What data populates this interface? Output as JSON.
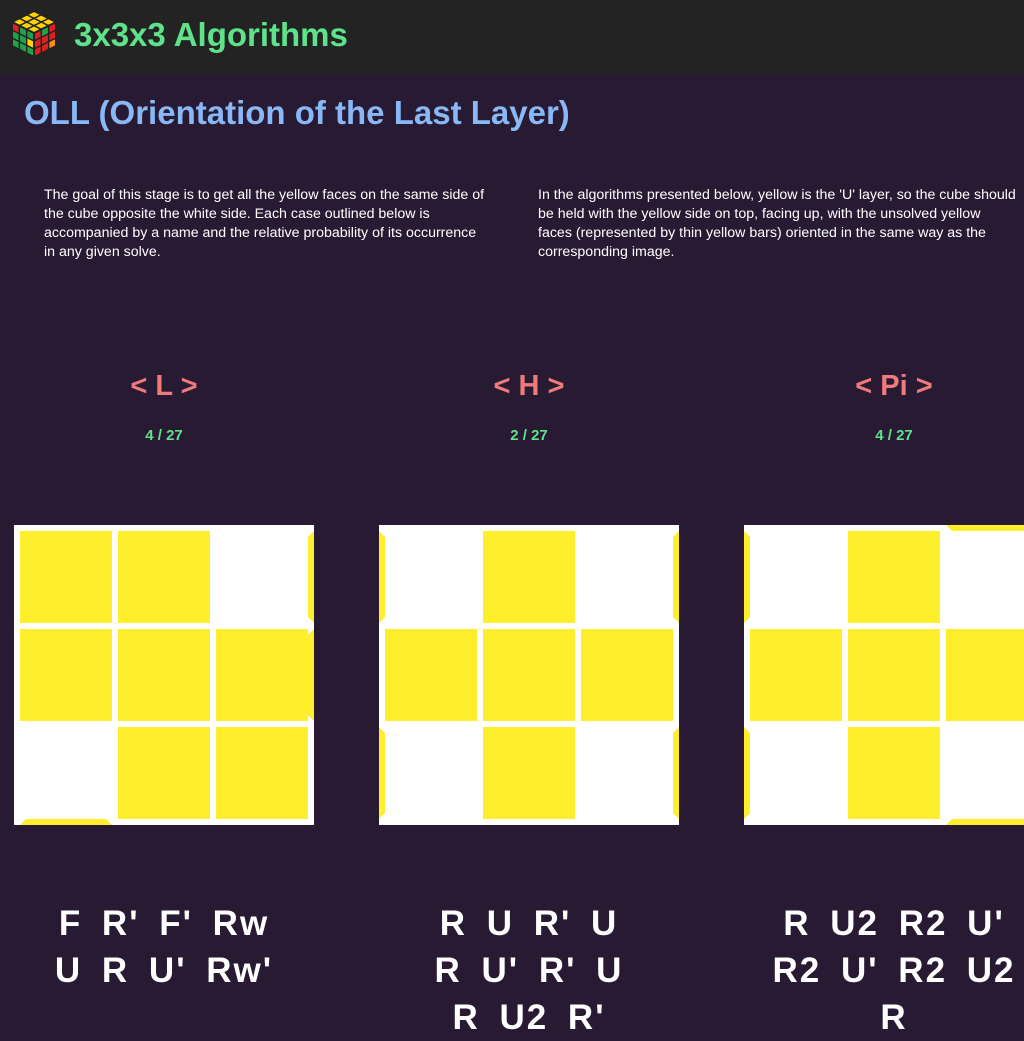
{
  "header": {
    "site_title": "3x3x3 Algorithms",
    "logo_icon": "rubiks-cube-icon"
  },
  "section": {
    "title": "OLL (Orientation of the Last Layer)",
    "intro_left": "The goal of this stage is to get all the yellow faces on the same side of the cube opposite the white side. Each case outlined below is accompanied by a name and the relative probability of its occurrence in any given solve.",
    "intro_right": "In the algorithms presented below, yellow is the 'U' layer, so the cube should be held with the yellow side on top, facing up, with the unsolved yellow faces (represented by thin yellow bars) oriented in the same way as the corresponding image."
  },
  "colors": {
    "yellow": "#ffee2c",
    "sticker_off": "#ffffff",
    "case_name": "#f07a7a",
    "probability": "#5ee38a",
    "title": "#88b8f5",
    "background": "#291a33"
  },
  "cases": [
    {
      "name": "< L >",
      "probability": "4 / 27",
      "grid": [
        [
          1,
          1,
          0
        ],
        [
          1,
          1,
          1
        ],
        [
          0,
          1,
          1
        ]
      ],
      "side_bars": [
        "right-0",
        "right-1",
        "bottom-0"
      ],
      "algorithm_lines": [
        "F R' F' Rw",
        "U R U' Rw'"
      ]
    },
    {
      "name": "< H >",
      "probability": "2 / 27",
      "grid": [
        [
          0,
          1,
          0
        ],
        [
          1,
          1,
          1
        ],
        [
          0,
          1,
          0
        ]
      ],
      "side_bars": [
        "left-0",
        "left-2",
        "right-0",
        "right-2"
      ],
      "algorithm_lines": [
        "R U R' U",
        "R U' R' U",
        "R U2 R'"
      ]
    },
    {
      "name": "< Pi >",
      "probability": "4 / 27",
      "grid": [
        [
          0,
          1,
          0
        ],
        [
          1,
          1,
          1
        ],
        [
          0,
          1,
          0
        ]
      ],
      "side_bars": [
        "left-0",
        "left-2",
        "top-2",
        "bottom-2"
      ],
      "algorithm_lines": [
        "R U2 R2 U'",
        "R2 U' R2 U2",
        "R"
      ]
    }
  ]
}
